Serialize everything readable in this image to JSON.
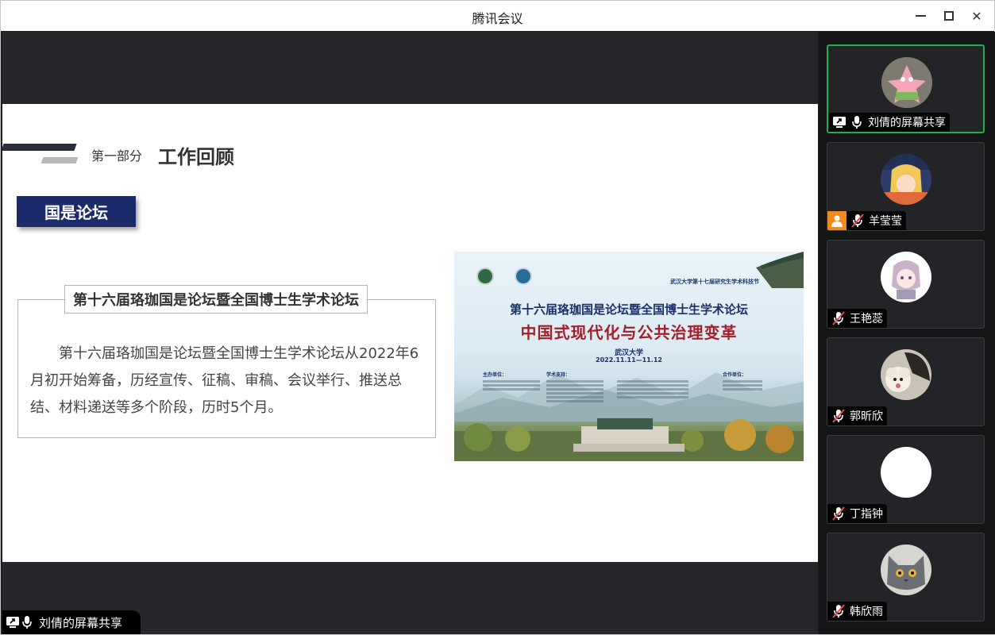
{
  "window": {
    "title": "腾讯会议",
    "icons": {
      "minimize": "minimize-icon",
      "maximize": "maximize-icon",
      "close": "close-icon"
    },
    "close_glyph": "✕"
  },
  "slide": {
    "part_label": "第一部分",
    "part_title": "工作回顾",
    "badge": "国是论坛",
    "box_title": "第十六届珞珈国是论坛暨全国博士生学术论坛",
    "body": "第十六届珞珈国是论坛暨全国博士生学术论坛从2022年6月初开始筹备，历经宣传、征稿、审稿、会议举行、推送总结、材料递送等多个阶段，历时5个月。",
    "poster": {
      "subtitle": "武汉大学第十七届研究生学术科技节",
      "headline": "第十六届珞珈国是论坛暨全国博士生学术论坛",
      "theme": "中国式现代化与公共治理变革",
      "org": "武汉大学",
      "date": "2022.11.11—11.12",
      "col1": "主办单位：",
      "col2": "学术支持：",
      "col3": "合作单位："
    }
  },
  "share_badge": {
    "label": "刘倩的屏幕共享",
    "icons": [
      "screen-share-icon",
      "mic-icon"
    ]
  },
  "participants": [
    {
      "name": "刘倩的屏幕共享",
      "mic": "mic-on",
      "sharing": true,
      "active": true,
      "avatar": "cartoon-star"
    },
    {
      "name": "羊莹莹",
      "mic": "mic-muted",
      "host_icon": "user-icon",
      "avatar": "cartoon-girl"
    },
    {
      "name": "王艳蕊",
      "mic": "mic-muted",
      "avatar": "anime-girl"
    },
    {
      "name": "郭昕欣",
      "mic": "mic-muted",
      "avatar": "dog-photo"
    },
    {
      "name": "丁指钟",
      "mic": "mic-muted",
      "avatar": "blank-white"
    },
    {
      "name": "韩欣雨",
      "mic": "mic-muted",
      "avatar": "cat-photo"
    }
  ],
  "colors": {
    "accent_green": "#1db152",
    "badge_blue": "#1c2b6c",
    "muted_red": "#e5484d"
  }
}
